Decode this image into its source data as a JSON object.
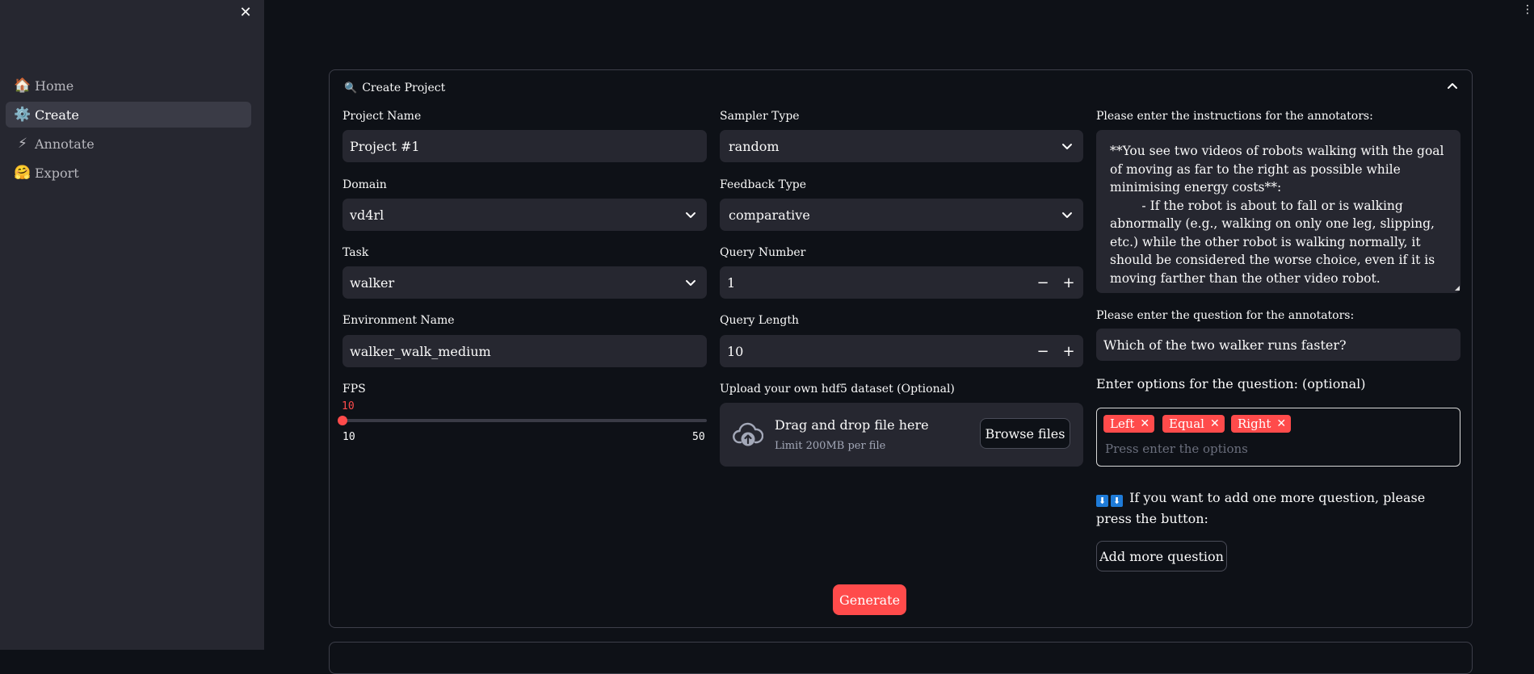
{
  "sidebar": {
    "items": [
      {
        "icon": "🏠",
        "icon_name": "house-icon",
        "label": "Home"
      },
      {
        "icon": "⚙️",
        "icon_name": "gear-icon",
        "label": "Create"
      },
      {
        "icon": "⚡",
        "icon_name": "lightning-icon",
        "label": "Annotate"
      },
      {
        "icon": "🤗",
        "icon_name": "hugging-face-icon",
        "label": "Export"
      }
    ],
    "active": "Create"
  },
  "expander": {
    "icon": "🔍",
    "title": "Create Project"
  },
  "form": {
    "project_name": {
      "label": "Project Name",
      "value": "Project #1"
    },
    "domain": {
      "label": "Domain",
      "value": "vd4rl"
    },
    "task": {
      "label": "Task",
      "value": "walker"
    },
    "environment": {
      "label": "Environment Name",
      "value": "walker_walk_medium"
    },
    "fps": {
      "label": "FPS",
      "value": "10",
      "min": "10",
      "max": "50",
      "level": 0
    },
    "sampler_type": {
      "label": "Sampler Type",
      "value": "random"
    },
    "feedback_type": {
      "label": "Feedback Type",
      "value": "comparative"
    },
    "query_number": {
      "label": "Query Number",
      "value": "1"
    },
    "query_length": {
      "label": "Query Length",
      "value": "10"
    },
    "upload": {
      "label": "Upload your own hdf5 dataset (Optional)",
      "title": "Drag and drop file here",
      "subtitle": "Limit 200MB per file",
      "button": "Browse files"
    },
    "instructions": {
      "label": "Please enter the instructions for the annotators:",
      "value": "**You see two videos of robots walking with the goal of moving as far to the right as possible while minimising energy costs**:\n        - If the robot is about to fall or is walking abnormally (e.g., walking on only one leg, slipping, etc.) while the other robot is walking normally, it should be considered the worse choice, even if it is moving farther than the other video robot."
    },
    "question": {
      "label": "Please enter the question for the annotators:",
      "value": "Which of the two walker runs faster?"
    },
    "options": {
      "label": "Enter options for the question: (optional)",
      "tags": [
        "Left",
        "Equal",
        "Right"
      ],
      "placeholder": "Press enter the options"
    },
    "more_info": {
      "emoji": "⬇",
      "text": "If you want to add one more question, please press the button:"
    },
    "add_more_button": "Add more question",
    "generate_button": "Generate"
  },
  "colors": {
    "accent": "#ff4b4b",
    "background": "#0e1117",
    "sidebar": "#262730",
    "input": "#262730"
  }
}
